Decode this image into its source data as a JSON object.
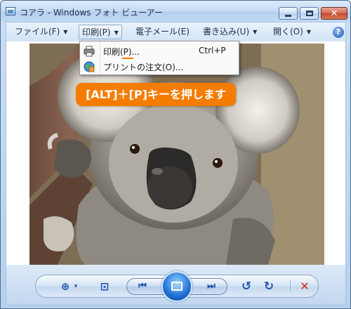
{
  "window": {
    "title": "コアラ - Windows フォト ビューアー"
  },
  "menubar": {
    "items": [
      {
        "label": "ファイル(F)",
        "arrow": "▼"
      },
      {
        "label": "印刷(P)",
        "arrow": "▼"
      },
      {
        "label": "電子メール(E)",
        "arrow": ""
      },
      {
        "label": "書き込み(U)",
        "arrow": "▼"
      },
      {
        "label": "開く(O)",
        "arrow": "▼"
      }
    ],
    "help_glyph": "?"
  },
  "dropdown": {
    "items": [
      {
        "label": "印刷(P)...",
        "shortcut": "Ctrl+P",
        "icon": "printer-icon"
      },
      {
        "label": "プリントの注文(O)...",
        "shortcut": "",
        "icon": "order-prints-globe-icon"
      }
    ]
  },
  "callout": {
    "text": "[ALT]＋[P]キーを押します"
  },
  "colors": {
    "callout_bg": "#f47c00",
    "accent_blue": "#1f56b0",
    "delete_red": "#d9261c"
  },
  "controls": {
    "zoom_glyph": "⊕",
    "zoom_arrow": "▾",
    "fit_glyph": "⊡",
    "prev_glyph": "⏮",
    "next_glyph": "⏭",
    "rotate_ccw_glyph": "↺",
    "rotate_cw_glyph": "↻",
    "delete_glyph": "✕"
  }
}
